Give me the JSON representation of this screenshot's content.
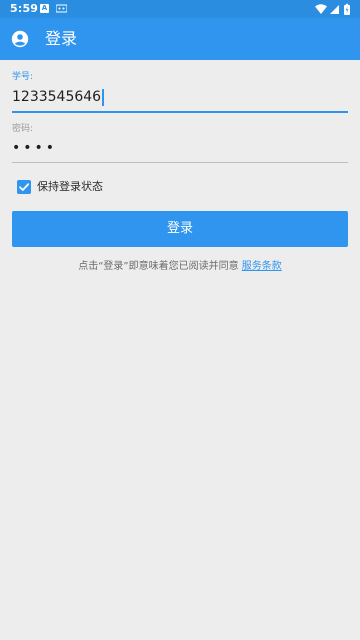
{
  "status_bar": {
    "time": "5:59",
    "notif_a_glyph": "A",
    "icons": [
      "notification-a-icon",
      "notification-android-icon",
      "wifi-icon",
      "cell-signal-icon",
      "battery-icon"
    ]
  },
  "app_bar": {
    "title": "登录",
    "icon": "account-circle-icon"
  },
  "form": {
    "student_id": {
      "label": "学号:",
      "value": "1233545646"
    },
    "password": {
      "label": "密码:",
      "masked_value": "••••"
    },
    "remember": {
      "label": "保持登录状态",
      "checked": true
    },
    "login_button": "登录"
  },
  "terms": {
    "prefix": "点击“登录”即意味着您已阅读并同意",
    "link": "服务条款"
  },
  "colors": {
    "status_bar": "#2b8de0",
    "app_bar": "#2f95ee",
    "accent": "#2f95ee",
    "background": "#ededed"
  }
}
